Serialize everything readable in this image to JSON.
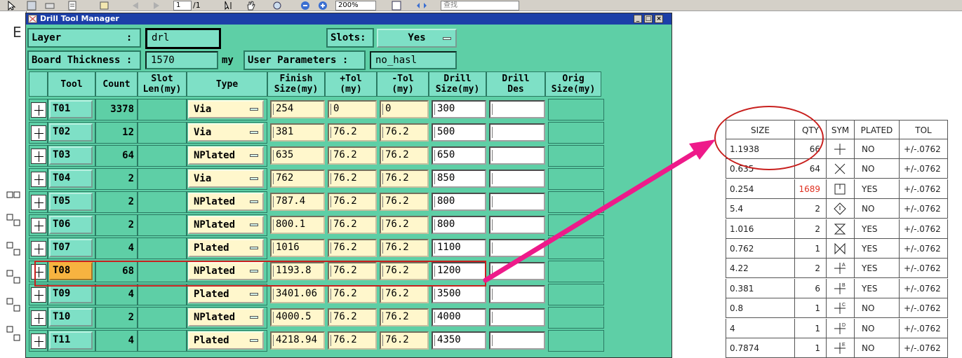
{
  "viewer_toolbar": {
    "page_current": "1",
    "page_total": "/1",
    "zoom": "200%",
    "search_placeholder": "查找"
  },
  "dialog": {
    "title": "Drill Tool Manager",
    "layer": {
      "label": "Layer           :",
      "value": "drl"
    },
    "slots": {
      "label": "Slots:",
      "value": "Yes"
    },
    "board_thickness": {
      "label": "Board Thickness :",
      "value": "1570",
      "unit": "my"
    },
    "user_parameters": {
      "label": "User Parameters :",
      "value": "no_hasl"
    },
    "columns": {
      "tool": "Tool",
      "count": "Count",
      "slot_len_1": "Slot",
      "slot_len_2": "Len(my)",
      "type": "Type",
      "finish_1": "Finish",
      "finish_2": "Size(my)",
      "ptol_1": "+Tol",
      "ptol_2": "(my)",
      "mtol_1": "-Tol",
      "mtol_2": "(my)",
      "drill_size_1": "Drill",
      "drill_size_2": "Size(my)",
      "drill_des_1": "Drill",
      "drill_des_2": "Des",
      "orig_1": "Orig",
      "orig_2": "Size(my)"
    },
    "rows": [
      {
        "tool": "T01",
        "count": "3378",
        "type": "Via",
        "finish": "254",
        "ptol": "0",
        "mtol": "0",
        "drill": "300"
      },
      {
        "tool": "T02",
        "count": "12",
        "type": "Via",
        "finish": "381",
        "ptol": "76.2",
        "mtol": "76.2",
        "drill": "500"
      },
      {
        "tool": "T03",
        "count": "64",
        "type": "NPlated",
        "finish": "635",
        "ptol": "76.2",
        "mtol": "76.2",
        "drill": "650"
      },
      {
        "tool": "T04",
        "count": "2",
        "type": "Via",
        "finish": "762",
        "ptol": "76.2",
        "mtol": "76.2",
        "drill": "850"
      },
      {
        "tool": "T05",
        "count": "2",
        "type": "NPlated",
        "finish": "787.4",
        "ptol": "76.2",
        "mtol": "76.2",
        "drill": "800"
      },
      {
        "tool": "T06",
        "count": "2",
        "type": "NPlated",
        "finish": "800.1",
        "ptol": "76.2",
        "mtol": "76.2",
        "drill": "800"
      },
      {
        "tool": "T07",
        "count": "4",
        "type": "Plated",
        "finish": "1016",
        "ptol": "76.2",
        "mtol": "76.2",
        "drill": "1100"
      },
      {
        "tool": "T08",
        "count": "68",
        "type": "NPlated",
        "finish": "1193.8",
        "ptol": "76.2",
        "mtol": "76.2",
        "drill": "1200",
        "selected": true
      },
      {
        "tool": "T09",
        "count": "4",
        "type": "Plated",
        "finish": "3401.06",
        "ptol": "76.2",
        "mtol": "76.2",
        "drill": "3500"
      },
      {
        "tool": "T10",
        "count": "2",
        "type": "NPlated",
        "finish": "4000.5",
        "ptol": "76.2",
        "mtol": "76.2",
        "drill": "4000"
      },
      {
        "tool": "T11",
        "count": "4",
        "type": "Plated",
        "finish": "4218.94",
        "ptol": "76.2",
        "mtol": "76.2",
        "drill": "4350"
      }
    ]
  },
  "drill_chart": {
    "headers": {
      "size": "SIZE",
      "qty": "QTY",
      "sym": "SYM",
      "plated": "PLATED",
      "tol": "TOL"
    },
    "rows": [
      {
        "size": "1.1938",
        "qty": "66",
        "sym": "plus",
        "plated": "NO",
        "tol": "+/-.0762"
      },
      {
        "size": "0.635",
        "qty": "64",
        "sym": "x",
        "plated": "NO",
        "tol": "+/-.0762"
      },
      {
        "size": "0.254",
        "qty": "1689",
        "sym": "box-t",
        "plated": "YES",
        "tol": "+/-.0762",
        "qty_color": "#e03020"
      },
      {
        "size": "5.4",
        "qty": "2",
        "sym": "diamond",
        "plated": "NO",
        "tol": "+/-.0762"
      },
      {
        "size": "1.016",
        "qty": "2",
        "sym": "hourglass",
        "plated": "YES",
        "tol": "+/-.0762"
      },
      {
        "size": "0.762",
        "qty": "1",
        "sym": "bowtie",
        "plated": "YES",
        "tol": "+/-.0762"
      },
      {
        "size": "4.22",
        "qty": "2",
        "sym": "plus-a",
        "sym_letter": "A",
        "plated": "YES",
        "tol": "+/-.0762"
      },
      {
        "size": "0.381",
        "qty": "6",
        "sym": "plus-b",
        "sym_letter": "B",
        "plated": "YES",
        "tol": "+/-.0762"
      },
      {
        "size": "0.8",
        "qty": "1",
        "sym": "plus-c",
        "sym_letter": "C",
        "plated": "NO",
        "tol": "+/-.0762"
      },
      {
        "size": "4",
        "qty": "1",
        "sym": "plus-d",
        "sym_letter": "D",
        "plated": "NO",
        "tol": "+/-.0762"
      },
      {
        "size": "0.7874",
        "qty": "1",
        "sym": "plus-e",
        "sym_letter": "E",
        "plated": "NO",
        "tol": "+/-.0762"
      }
    ]
  },
  "colors": {
    "dialog_bg": "#5ecfa6",
    "field_bg": "#7ee0c6",
    "input_bg": "#fff7cc",
    "selected_tool": "#f7b340",
    "annotation_red": "#c8201e",
    "arrow_magenta": "#ee1a8a"
  }
}
